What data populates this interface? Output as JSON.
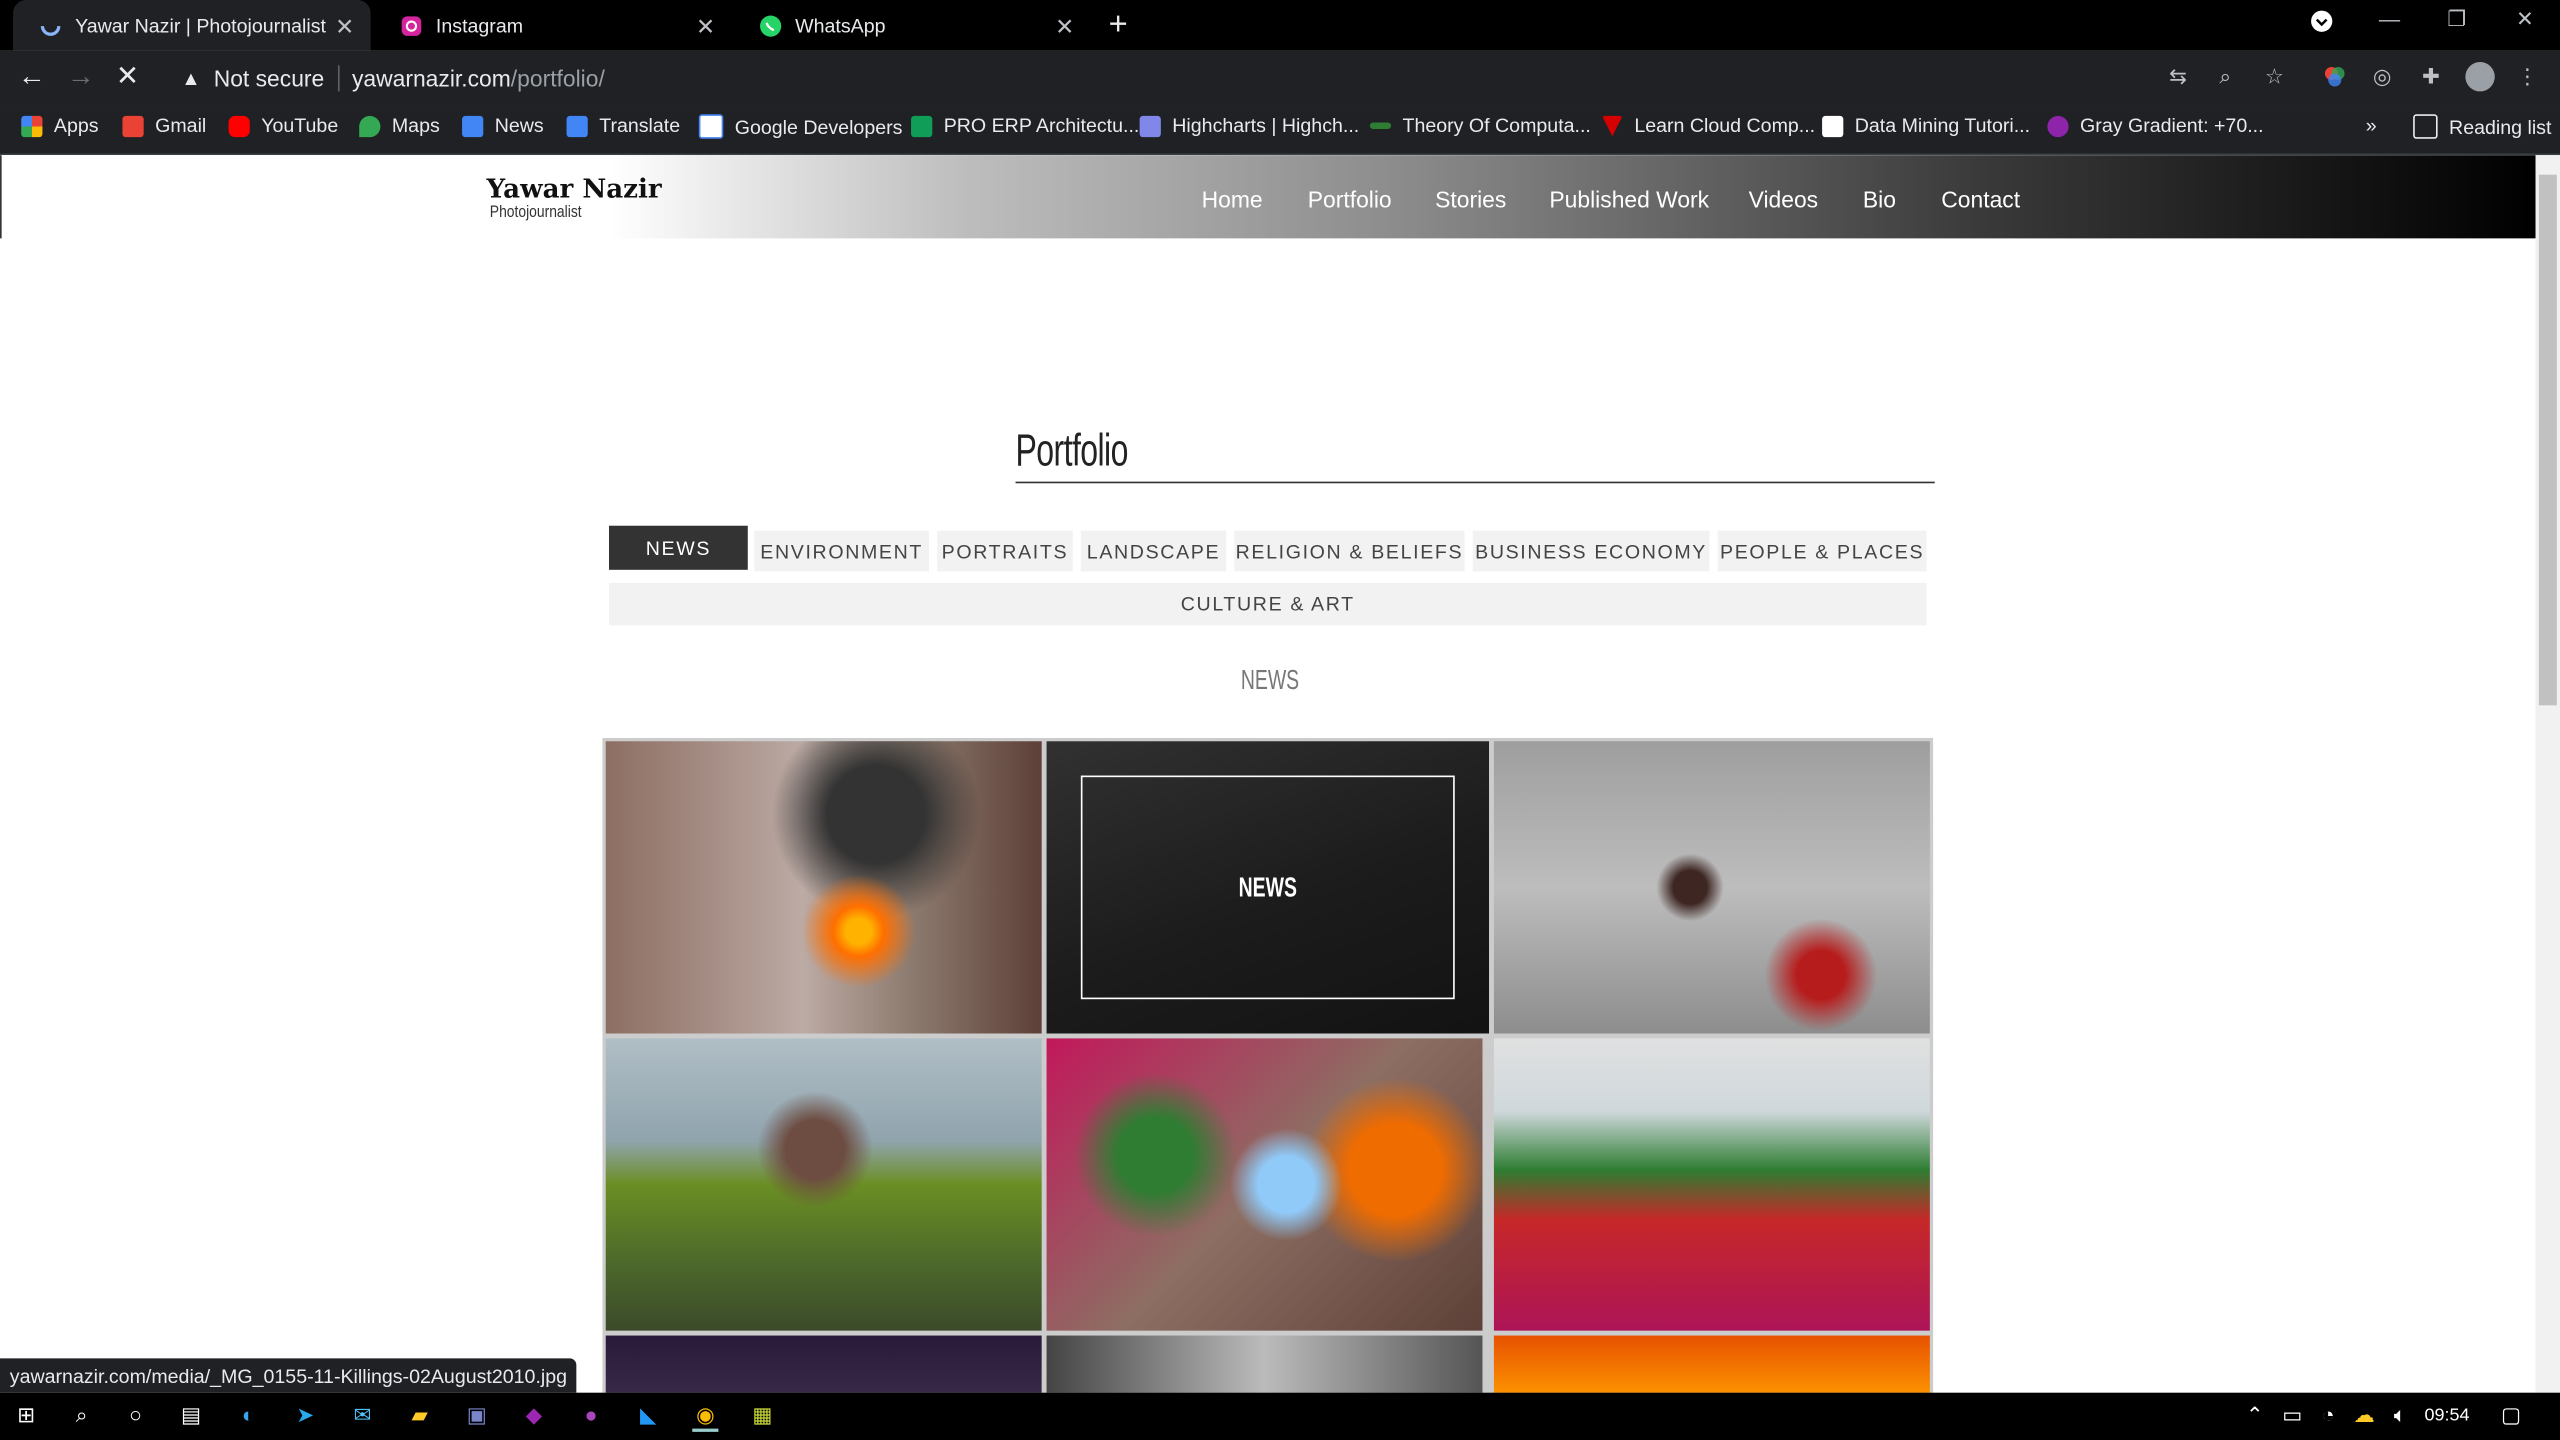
{
  "browser": {
    "tabs": [
      {
        "title": "Yawar Nazir | Photojournalist",
        "active": true
      },
      {
        "title": "Instagram",
        "active": false
      },
      {
        "title": "WhatsApp",
        "active": false
      }
    ],
    "omnibox": {
      "security": "Not secure",
      "host": "yawarnazir.com",
      "path": "/portfolio/"
    },
    "bookmarks": [
      "Apps",
      "Gmail",
      "YouTube",
      "Maps",
      "News",
      "Translate",
      "Google Developers",
      "PRO ERP Architectu...",
      "Highcharts | Highch...",
      "Theory Of Computa...",
      "Learn Cloud Comp...",
      "Data Mining Tutori...",
      "Gray Gradient: +70..."
    ],
    "bookmarks_overflow": "»",
    "reading_list": "Reading list",
    "status_url": "yawarnazir.com/media/_MG_0155-11-Killings-02August2010.jpg"
  },
  "site": {
    "logo_name": "Yawar Nazir",
    "logo_sub": "Photojournalist",
    "nav": [
      "Home",
      "Portfolio",
      "Stories",
      "Published Work",
      "Videos",
      "Bio",
      "Contact"
    ],
    "page_title": "Portfolio",
    "filters": [
      "NEWS",
      "ENVIRONMENT",
      "PORTRAITS",
      "LANDSCAPE",
      "RELIGION & BELIEFS",
      "BUSINESS ECONOMY",
      "PEOPLE & PLACES",
      "CULTURE & ART"
    ],
    "active_filter": "NEWS",
    "section_title": "NEWS",
    "hover_label": "NEWS"
  },
  "taskbar": {
    "time": "09:54"
  }
}
